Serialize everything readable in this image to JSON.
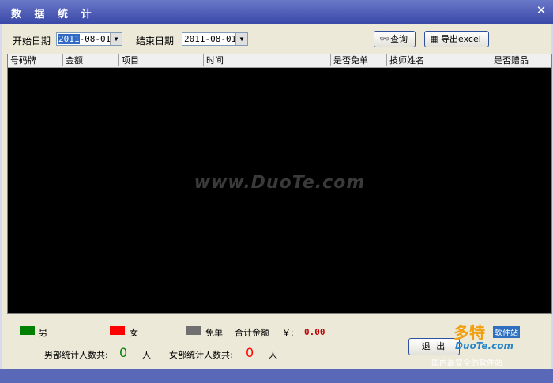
{
  "window": {
    "title": "数 据 统 计",
    "close": "✕"
  },
  "filters": {
    "start_label": "开始日期",
    "start_value_sel": "2011",
    "start_value_rest": "-08-01",
    "end_label": "结束日期",
    "end_value": "2011-08-01"
  },
  "buttons": {
    "query": "查询",
    "export": "导出excel",
    "exit": "退 出"
  },
  "table": {
    "columns": [
      "号码牌",
      "金额",
      "项目",
      "时间",
      "是否免单",
      "技师姓名",
      "是否赠品"
    ]
  },
  "watermark": "www.DuoTe.com",
  "legend": {
    "male": {
      "label": "男",
      "color": "#008000"
    },
    "female": {
      "label": "女",
      "color": "#ff0000"
    },
    "free": {
      "label": "免单",
      "color": "#707070"
    },
    "total_label": "合计金额",
    "currency": "￥:",
    "total_value": "0.00"
  },
  "stats": {
    "male_label": "男部统计人数共:",
    "male_count": "0",
    "female_label": "女部统计人数共:",
    "female_count": "0",
    "unit": "人"
  },
  "logo": {
    "brand": "多特",
    "tag": "软件站",
    "site": "DuoTe.com",
    "slogan": "国内最安全的软件站"
  }
}
